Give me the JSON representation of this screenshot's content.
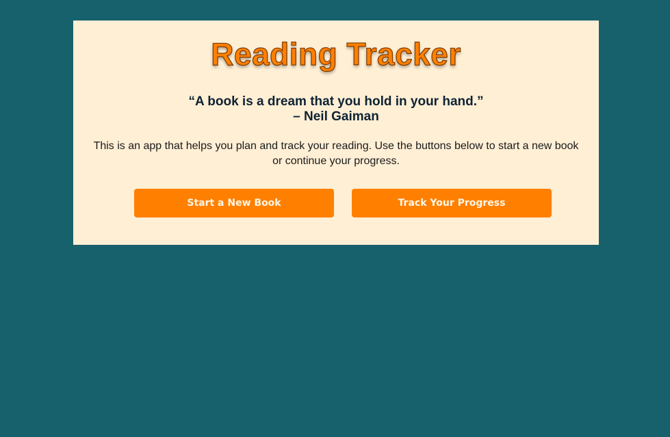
{
  "app": {
    "title": "Reading Tracker"
  },
  "quote": {
    "text": "“A book is a dream that you hold in your hand.”",
    "author": "– Neil Gaiman"
  },
  "description": "This is an app that helps you plan and track your reading. Use the buttons below to start a new book or continue your progress.",
  "buttons": {
    "start_new_book": "Start a New Book",
    "track_progress": "Track Your Progress"
  },
  "colors": {
    "background": "#17616d",
    "card": "#ffefd5",
    "accent": "#ff8000"
  }
}
